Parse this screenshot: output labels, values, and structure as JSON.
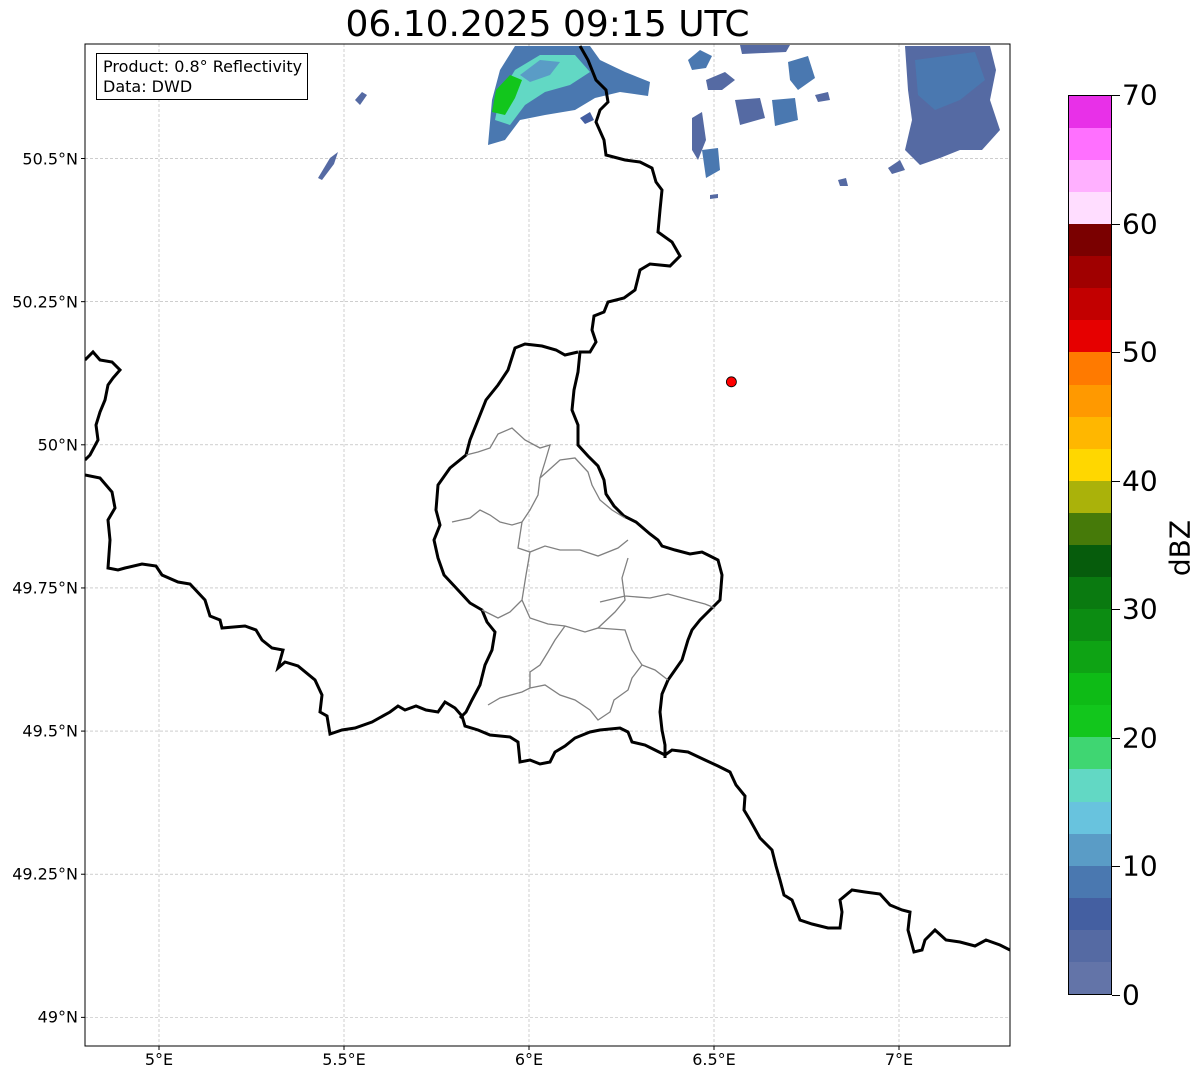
{
  "title": "06.10.2025 09:15 UTC",
  "info": {
    "product": "Product: 0.8° Reflectivity",
    "data": "Data: DWD"
  },
  "map": {
    "lon_range": [
      4.8,
      7.3
    ],
    "lat_range": [
      48.95,
      50.7
    ],
    "lon_ticks": [
      {
        "value": 5.0,
        "label": "5°E"
      },
      {
        "value": 5.5,
        "label": "5.5°E"
      },
      {
        "value": 6.0,
        "label": "6°E"
      },
      {
        "value": 6.5,
        "label": "6.5°E"
      },
      {
        "value": 7.0,
        "label": "7°E"
      }
    ],
    "lat_ticks": [
      {
        "value": 49.0,
        "label": "49°N"
      },
      {
        "value": 49.25,
        "label": "49.25°N"
      },
      {
        "value": 49.5,
        "label": "49.5°N"
      },
      {
        "value": 49.75,
        "label": "49.75°N"
      },
      {
        "value": 50.0,
        "label": "50°N"
      },
      {
        "value": 50.25,
        "label": "50.25°N"
      },
      {
        "value": 50.5,
        "label": "50.5°N"
      }
    ],
    "grid": true,
    "marker": {
      "lon": 6.547,
      "lat": 50.11,
      "color": "#ff0000"
    }
  },
  "colorbar": {
    "label": "dBZ",
    "min": 0,
    "max": 70,
    "tick_labels": [
      "0",
      "10",
      "20",
      "30",
      "40",
      "50",
      "60",
      "70"
    ],
    "colors": [
      "#6374a8",
      "#556aa3",
      "#445fa1",
      "#4a78b0",
      "#5a9cc6",
      "#68c3de",
      "#62d8c4",
      "#3fd672",
      "#12c61c",
      "#0ebb16",
      "#0ea314",
      "#0c8c12",
      "#0a7a10",
      "#065c0c",
      "#467a09",
      "#aab20a",
      "#ffd700",
      "#ffb700",
      "#ff9900",
      "#ff7a00",
      "#e60000",
      "#c20000",
      "#a00000",
      "#7a0000",
      "#ffddff",
      "#ffb0ff",
      "#ff70ff",
      "#e830e8"
    ]
  }
}
